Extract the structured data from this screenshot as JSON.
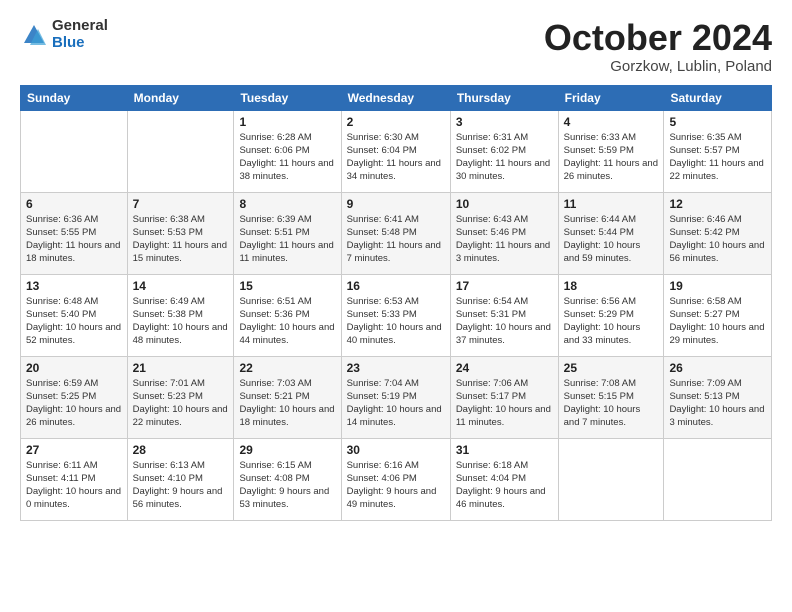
{
  "header": {
    "logo_general": "General",
    "logo_blue": "Blue",
    "month_title": "October 2024",
    "location": "Gorzkow, Lublin, Poland"
  },
  "days_of_week": [
    "Sunday",
    "Monday",
    "Tuesday",
    "Wednesday",
    "Thursday",
    "Friday",
    "Saturday"
  ],
  "weeks": [
    [
      {
        "day": "",
        "info": ""
      },
      {
        "day": "",
        "info": ""
      },
      {
        "day": "1",
        "info": "Sunrise: 6:28 AM\nSunset: 6:06 PM\nDaylight: 11 hours and 38 minutes."
      },
      {
        "day": "2",
        "info": "Sunrise: 6:30 AM\nSunset: 6:04 PM\nDaylight: 11 hours and 34 minutes."
      },
      {
        "day": "3",
        "info": "Sunrise: 6:31 AM\nSunset: 6:02 PM\nDaylight: 11 hours and 30 minutes."
      },
      {
        "day": "4",
        "info": "Sunrise: 6:33 AM\nSunset: 5:59 PM\nDaylight: 11 hours and 26 minutes."
      },
      {
        "day": "5",
        "info": "Sunrise: 6:35 AM\nSunset: 5:57 PM\nDaylight: 11 hours and 22 minutes."
      }
    ],
    [
      {
        "day": "6",
        "info": "Sunrise: 6:36 AM\nSunset: 5:55 PM\nDaylight: 11 hours and 18 minutes."
      },
      {
        "day": "7",
        "info": "Sunrise: 6:38 AM\nSunset: 5:53 PM\nDaylight: 11 hours and 15 minutes."
      },
      {
        "day": "8",
        "info": "Sunrise: 6:39 AM\nSunset: 5:51 PM\nDaylight: 11 hours and 11 minutes."
      },
      {
        "day": "9",
        "info": "Sunrise: 6:41 AM\nSunset: 5:48 PM\nDaylight: 11 hours and 7 minutes."
      },
      {
        "day": "10",
        "info": "Sunrise: 6:43 AM\nSunset: 5:46 PM\nDaylight: 11 hours and 3 minutes."
      },
      {
        "day": "11",
        "info": "Sunrise: 6:44 AM\nSunset: 5:44 PM\nDaylight: 10 hours and 59 minutes."
      },
      {
        "day": "12",
        "info": "Sunrise: 6:46 AM\nSunset: 5:42 PM\nDaylight: 10 hours and 56 minutes."
      }
    ],
    [
      {
        "day": "13",
        "info": "Sunrise: 6:48 AM\nSunset: 5:40 PM\nDaylight: 10 hours and 52 minutes."
      },
      {
        "day": "14",
        "info": "Sunrise: 6:49 AM\nSunset: 5:38 PM\nDaylight: 10 hours and 48 minutes."
      },
      {
        "day": "15",
        "info": "Sunrise: 6:51 AM\nSunset: 5:36 PM\nDaylight: 10 hours and 44 minutes."
      },
      {
        "day": "16",
        "info": "Sunrise: 6:53 AM\nSunset: 5:33 PM\nDaylight: 10 hours and 40 minutes."
      },
      {
        "day": "17",
        "info": "Sunrise: 6:54 AM\nSunset: 5:31 PM\nDaylight: 10 hours and 37 minutes."
      },
      {
        "day": "18",
        "info": "Sunrise: 6:56 AM\nSunset: 5:29 PM\nDaylight: 10 hours and 33 minutes."
      },
      {
        "day": "19",
        "info": "Sunrise: 6:58 AM\nSunset: 5:27 PM\nDaylight: 10 hours and 29 minutes."
      }
    ],
    [
      {
        "day": "20",
        "info": "Sunrise: 6:59 AM\nSunset: 5:25 PM\nDaylight: 10 hours and 26 minutes."
      },
      {
        "day": "21",
        "info": "Sunrise: 7:01 AM\nSunset: 5:23 PM\nDaylight: 10 hours and 22 minutes."
      },
      {
        "day": "22",
        "info": "Sunrise: 7:03 AM\nSunset: 5:21 PM\nDaylight: 10 hours and 18 minutes."
      },
      {
        "day": "23",
        "info": "Sunrise: 7:04 AM\nSunset: 5:19 PM\nDaylight: 10 hours and 14 minutes."
      },
      {
        "day": "24",
        "info": "Sunrise: 7:06 AM\nSunset: 5:17 PM\nDaylight: 10 hours and 11 minutes."
      },
      {
        "day": "25",
        "info": "Sunrise: 7:08 AM\nSunset: 5:15 PM\nDaylight: 10 hours and 7 minutes."
      },
      {
        "day": "26",
        "info": "Sunrise: 7:09 AM\nSunset: 5:13 PM\nDaylight: 10 hours and 3 minutes."
      }
    ],
    [
      {
        "day": "27",
        "info": "Sunrise: 6:11 AM\nSunset: 4:11 PM\nDaylight: 10 hours and 0 minutes."
      },
      {
        "day": "28",
        "info": "Sunrise: 6:13 AM\nSunset: 4:10 PM\nDaylight: 9 hours and 56 minutes."
      },
      {
        "day": "29",
        "info": "Sunrise: 6:15 AM\nSunset: 4:08 PM\nDaylight: 9 hours and 53 minutes."
      },
      {
        "day": "30",
        "info": "Sunrise: 6:16 AM\nSunset: 4:06 PM\nDaylight: 9 hours and 49 minutes."
      },
      {
        "day": "31",
        "info": "Sunrise: 6:18 AM\nSunset: 4:04 PM\nDaylight: 9 hours and 46 minutes."
      },
      {
        "day": "",
        "info": ""
      },
      {
        "day": "",
        "info": ""
      }
    ]
  ]
}
